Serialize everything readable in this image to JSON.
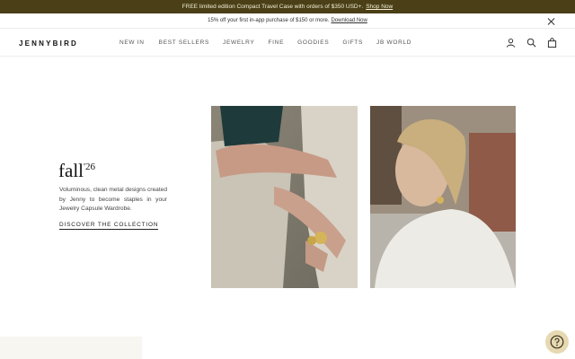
{
  "promo": {
    "text": "FREE limited edition Compact Travel Case with orders of $350 USD+.",
    "link": "Shop Now"
  },
  "subpromo": {
    "text": "15% off your first in-app purchase of $150 or more.",
    "link": "Download Now"
  },
  "header": {
    "logo": "JENNYBIRD",
    "nav": [
      "NEW IN",
      "BEST SELLERS",
      "JEWELRY",
      "FINE",
      "GOODIES",
      "GIFTS",
      "JB WORLD"
    ],
    "icons": [
      "account-icon",
      "search-icon",
      "bag-icon"
    ]
  },
  "hero": {
    "title": "fall",
    "title_sup": "'26",
    "description": "Voluminous, clean metal designs created by Jenny to become staples in your Jewelry Capsule Wardrobe.",
    "cta": "DISCOVER THE COLLECTION"
  },
  "colors": {
    "promo_bg": "#4a3f16",
    "help_bg": "#e6d9b2"
  }
}
